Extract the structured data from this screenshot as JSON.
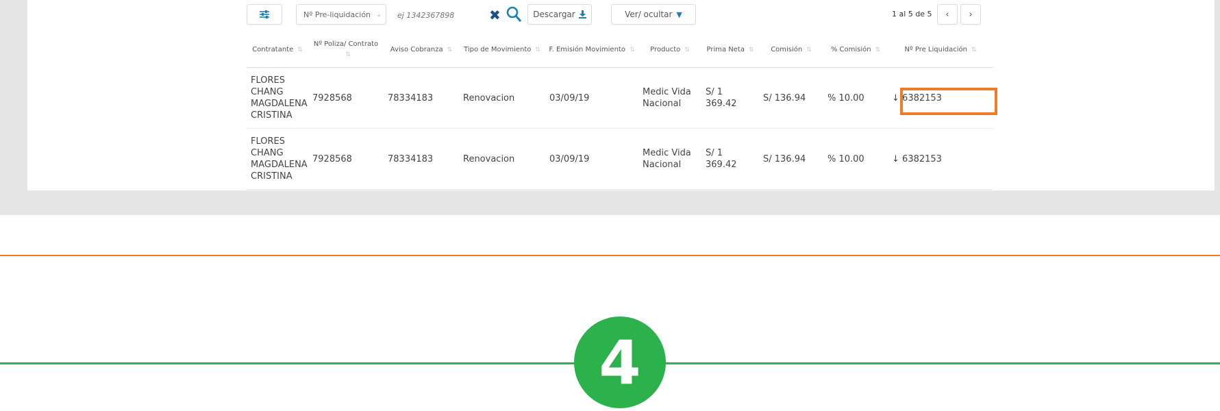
{
  "toolbar": {
    "filter_select": "Nº Pre-liquidación",
    "search_placeholder": "ej 1342367898",
    "download_label": "Descargar",
    "toggle_label": "Ver/ ocultar",
    "page_count": "1 al 5 de 5"
  },
  "icons": {
    "filter": "sliders-icon",
    "clear": "close-icon",
    "search": "search-icon",
    "download": "download-icon",
    "toggle": "chevron-down-icon",
    "prev": "chevron-left-icon",
    "next": "chevron-right-icon",
    "row_download": "download-arrow-icon"
  },
  "table": {
    "columns": [
      "Contratante",
      "Nº Poliza/ Contrato",
      "Aviso Cobranza",
      "Tipo de Movimiento",
      "F. Emisión Movimiento",
      "Producto",
      "Prima Neta",
      "Comisión",
      "% Comisión",
      "Nº Pre Liquidación"
    ],
    "rows": [
      {
        "contratante": "FLORES CHANG MAGDALENA CRISTINA",
        "poliza": "7928568",
        "aviso": "78334183",
        "tipo": "Renovacion",
        "fecha": "03/09/19",
        "producto": "Medic Vida Nacional",
        "prima": "S/ 1 369.42",
        "comision": "S/ 136.94",
        "porcentaje": "% 10.00",
        "preliq": "6382153"
      },
      {
        "contratante": "FLORES CHANG MAGDALENA CRISTINA",
        "poliza": "7928568",
        "aviso": "78334183",
        "tipo": "Renovacion",
        "fecha": "03/09/19",
        "producto": "Medic Vida Nacional",
        "prima": "S/ 1 369.42",
        "comision": "S/ 136.94",
        "porcentaje": "% 10.00",
        "preliq": "6382153"
      }
    ]
  },
  "step": {
    "number": "4"
  },
  "colors": {
    "accent_link": "#2a8fc3",
    "highlight": "#f07c2a",
    "step_green": "#2db14d",
    "background_band": "#e6e6e6"
  }
}
